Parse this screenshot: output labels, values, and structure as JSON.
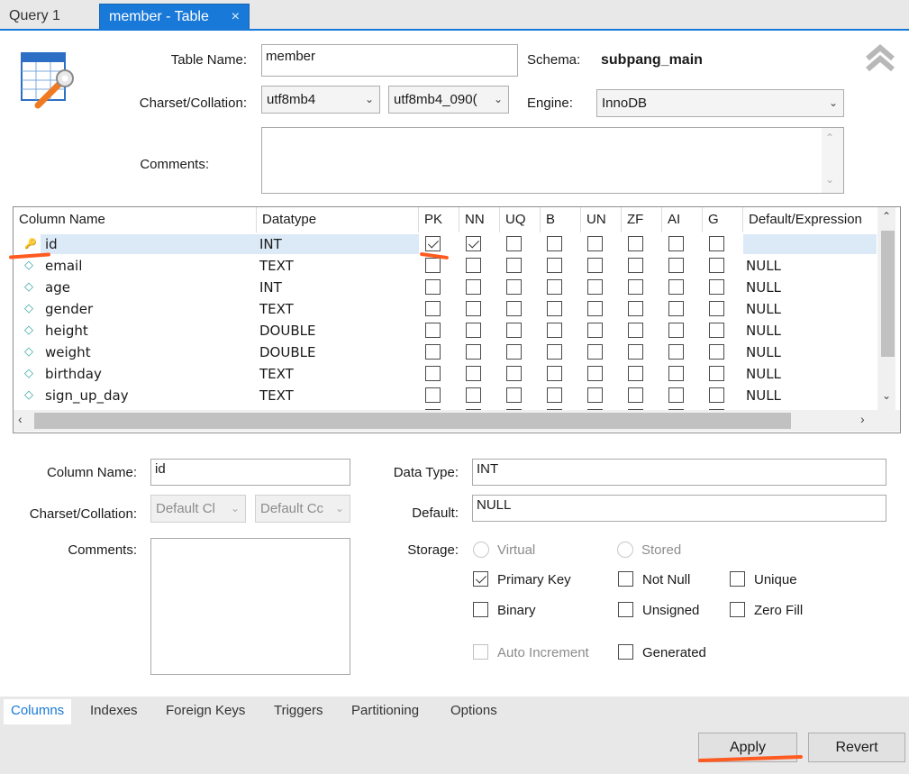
{
  "tabs": {
    "query": "Query 1",
    "member": "member - Table",
    "close": "×"
  },
  "table": {
    "name_label": "Table Name:",
    "name_value": "member",
    "schema_label": "Schema:",
    "schema_value": "subpang_main",
    "charset_label": "Charset/Collation:",
    "charset_value": "utf8mb4",
    "collation_value": "utf8mb4_090(",
    "engine_label": "Engine:",
    "engine_value": "InnoDB",
    "comments_label": "Comments:",
    "comments_value": ""
  },
  "grid": {
    "headers": [
      "Column Name",
      "Datatype",
      "PK",
      "NN",
      "UQ",
      "B",
      "UN",
      "ZF",
      "AI",
      "G",
      "Default/Expression"
    ],
    "rows": [
      {
        "name": "id",
        "type": "INT",
        "pk": true,
        "nn": true,
        "default": ""
      },
      {
        "name": "email",
        "type": "TEXT",
        "pk": false,
        "nn": false,
        "default": "NULL"
      },
      {
        "name": "age",
        "type": "INT",
        "pk": false,
        "nn": false,
        "default": "NULL"
      },
      {
        "name": "gender",
        "type": "TEXT",
        "pk": false,
        "nn": false,
        "default": "NULL"
      },
      {
        "name": "height",
        "type": "DOUBLE",
        "pk": false,
        "nn": false,
        "default": "NULL"
      },
      {
        "name": "weight",
        "type": "DOUBLE",
        "pk": false,
        "nn": false,
        "default": "NULL"
      },
      {
        "name": "birthday",
        "type": "TEXT",
        "pk": false,
        "nn": false,
        "default": "NULL"
      },
      {
        "name": "sign_up_day",
        "type": "TEXT",
        "pk": false,
        "nn": false,
        "default": "NULL"
      }
    ]
  },
  "detail": {
    "column_name_label": "Column Name:",
    "column_name_value": "id",
    "charset_label": "Charset/Collation:",
    "charset_value": "Default Cl",
    "collation_value": "Default Cc",
    "comments_label": "Comments:",
    "data_type_label": "Data Type:",
    "data_type_value": "INT",
    "default_label": "Default:",
    "default_value": "NULL",
    "storage_label": "Storage:",
    "virtual": "Virtual",
    "stored": "Stored",
    "primary_key": "Primary Key",
    "not_null": "Not Null",
    "unique": "Unique",
    "binary": "Binary",
    "unsigned": "Unsigned",
    "zero_fill": "Zero Fill",
    "auto_increment": "Auto Increment",
    "generated": "Generated"
  },
  "bottom_tabs": [
    "Columns",
    "Indexes",
    "Foreign Keys",
    "Triggers",
    "Partitioning",
    "Options"
  ],
  "buttons": {
    "apply": "Apply",
    "revert": "Revert"
  },
  "colors": {
    "accent": "#1979d8",
    "annotation": "#ff5a1f",
    "selected_row": "#dceaf8"
  }
}
